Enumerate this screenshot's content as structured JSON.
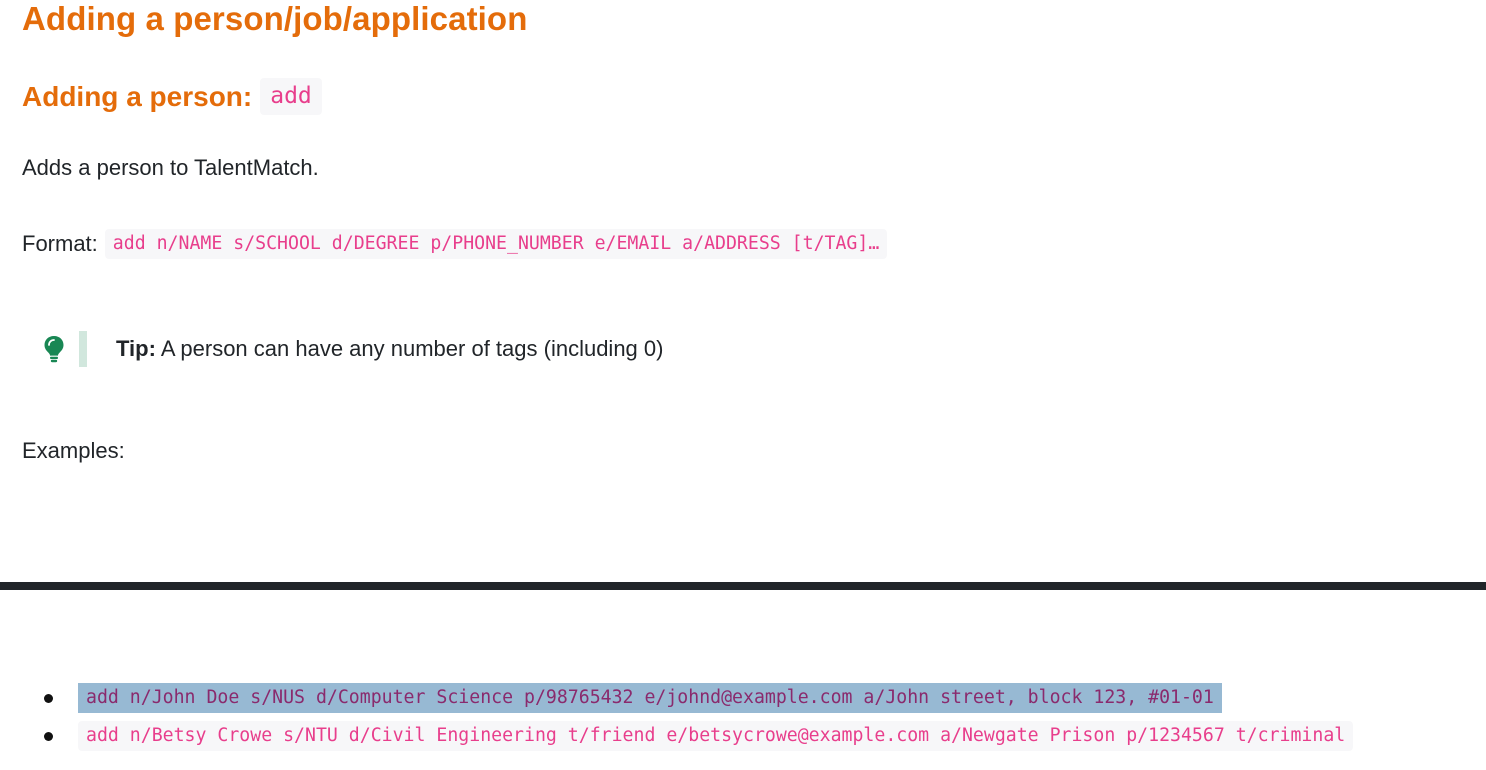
{
  "section": {
    "title": "Adding a person/job/application"
  },
  "subsection": {
    "title": "Adding a person:",
    "command": "add"
  },
  "description": "Adds a person to TalentMatch.",
  "format": {
    "label": "Format:",
    "code": "add n/NAME s/SCHOOL d/DEGREE p/PHONE_NUMBER e/EMAIL a/ADDRESS [t/TAG]…"
  },
  "tip": {
    "icon": "lightbulb-icon",
    "label": "Tip:",
    "text": " A person can have any number of tags (including 0)"
  },
  "examples": {
    "label": "Examples:",
    "items": [
      "add n/John Doe s/NUS d/Computer Science p/98765432 e/johnd@example.com a/John street, block 123, #01-01",
      "add n/Betsy Crowe s/NTU d/Civil Engineering t/friend e/betsycrowe@example.com a/Newgate Prison p/1234567 t/criminal"
    ]
  },
  "colors": {
    "heading": "#e46c0a",
    "code": "#e83e8c",
    "code_bg": "#f7f7f9",
    "tip_bar": "#d1e7dd",
    "tip_icon": "#198754",
    "selection": "#97b9d3"
  }
}
